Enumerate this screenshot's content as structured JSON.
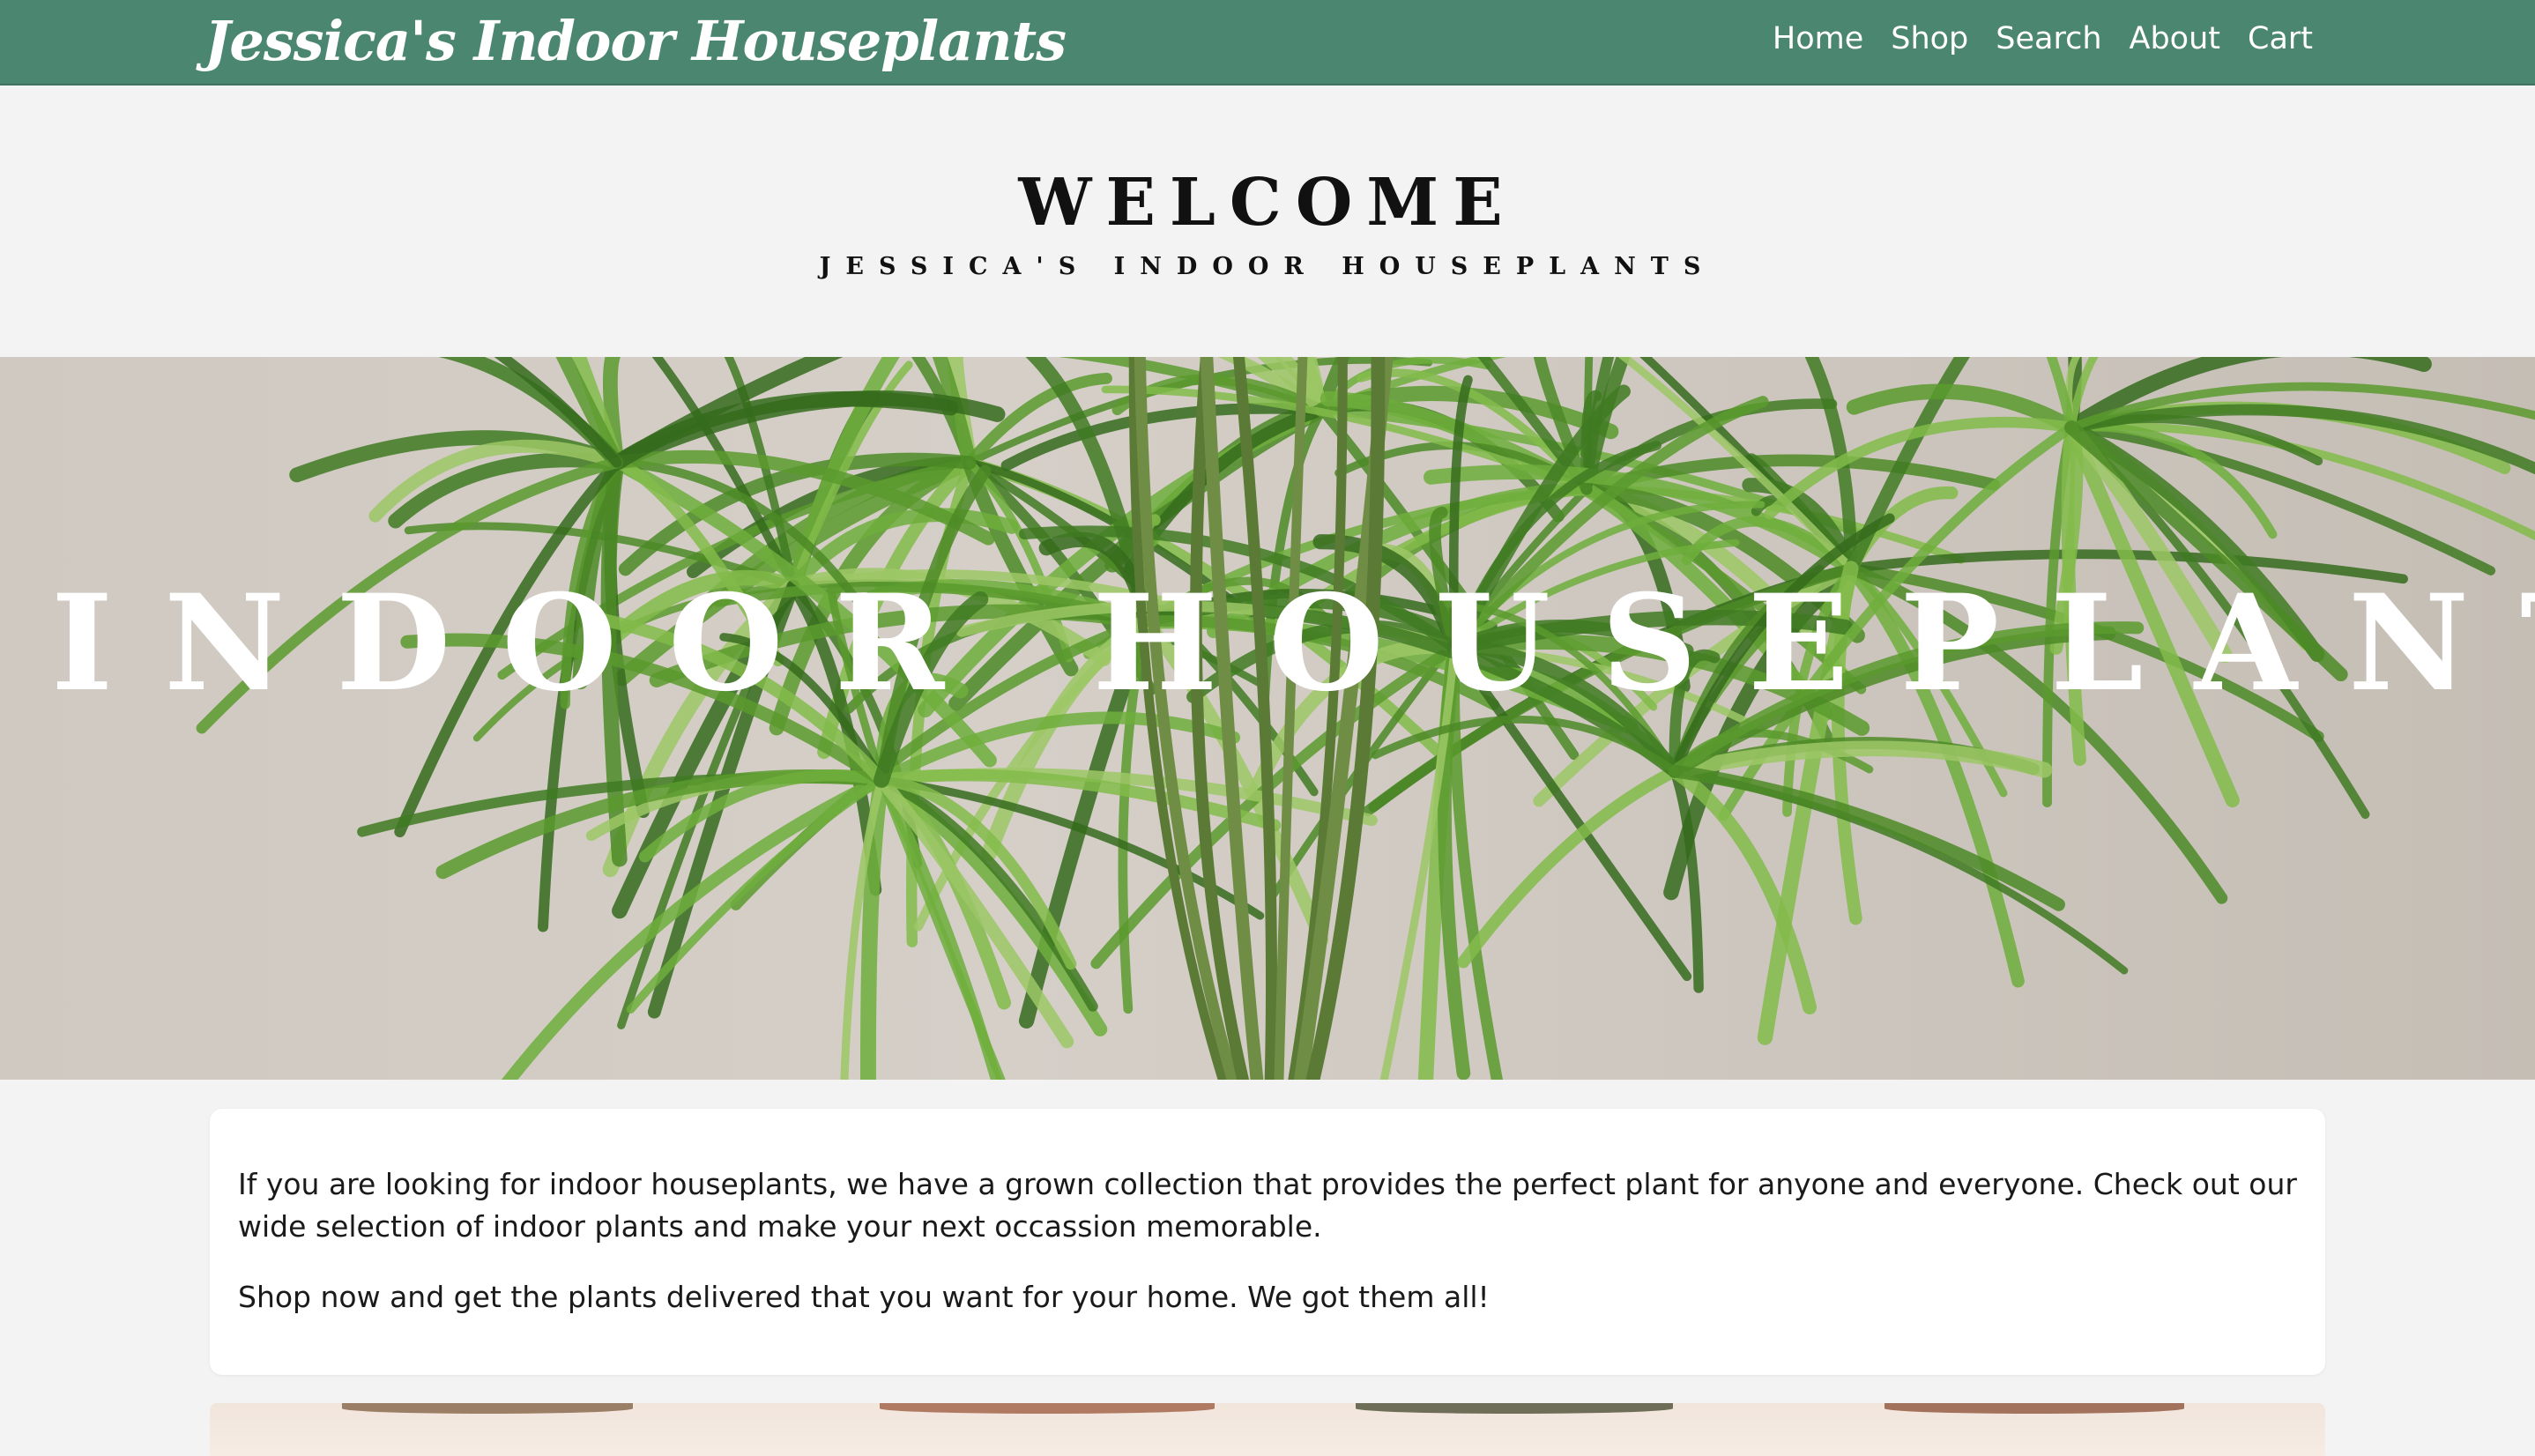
{
  "navbar": {
    "brand": "Jessica's Indoor Houseplants",
    "links": [
      {
        "label": "Home"
      },
      {
        "label": "Shop"
      },
      {
        "label": "Search"
      },
      {
        "label": "About"
      },
      {
        "label": "Cart"
      }
    ]
  },
  "welcome": {
    "title": "WELCOME",
    "subtitle": "JESSICA'S INDOOR HOUSEPLANTS"
  },
  "hero": {
    "title": "INDOOR HOUSEPLANTS",
    "image": "palm-plant-photo"
  },
  "intro": {
    "paragraphs": [
      "If you are looking for indoor houseplants, we have a grown collection that provides the perfect plant for anyone and everyone. Check out our wide selection of indoor plants and make your next occassion memorable.",
      "Shop now and get the plants delivered that you want for your home. We got them all!"
    ]
  },
  "colors": {
    "navbar": "#4b8670",
    "page_background": "#f3f3f3",
    "card_background": "#ffffff",
    "text": "#1a1a1a"
  }
}
